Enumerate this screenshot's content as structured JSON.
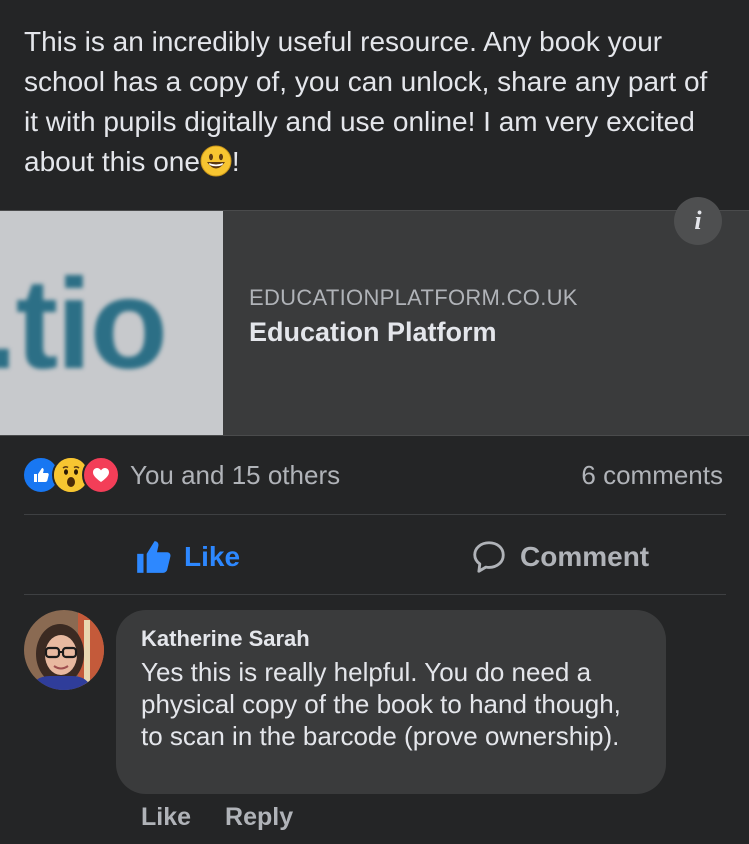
{
  "post": {
    "text": "This is an incredibly useful resource. Any book your school has a copy of, you can unlock, share any part of it with pupils digitally and use online! I am very excited about this one",
    "text_suffix": "!",
    "emoji": "grinning-face-icon"
  },
  "link_preview": {
    "thumbnail_text": ".tio",
    "domain": "EDUCATIONPLATFORM.CO.UK",
    "title": "Education Platform",
    "info_label": "i"
  },
  "reactions": {
    "icons": [
      "like-reaction-icon",
      "wow-reaction-icon",
      "love-reaction-icon"
    ],
    "summary": "You and 15 others",
    "comments_count": "6 comments"
  },
  "actions": {
    "like_label": "Like",
    "comment_label": "Comment"
  },
  "comment": {
    "author": "Katherine Sarah",
    "text": "Yes this is really helpful. You do need a physical copy of the book to hand though, to scan in the barcode (prove ownership).",
    "like_label": "Like",
    "reply_label": "Reply"
  },
  "colors": {
    "background": "#242526",
    "card": "#3a3b3c",
    "accent_blue": "#2d88ff",
    "secondary_text": "#b0b3b8"
  }
}
